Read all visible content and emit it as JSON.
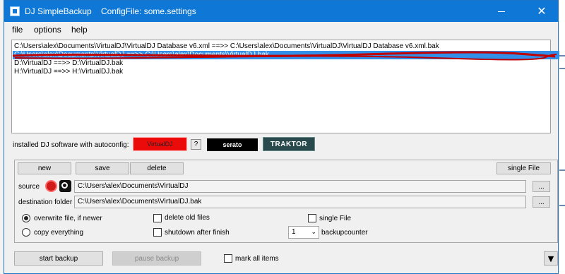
{
  "window": {
    "app_title": "DJ SimpleBackup",
    "config_title": "ConfigFile: some.settings",
    "minimize_glyph": "",
    "close_glyph": "✕"
  },
  "menu": [
    {
      "label": "file"
    },
    {
      "label": "options"
    },
    {
      "label": "help"
    }
  ],
  "backup_list": [
    {
      "text": "C:\\Users\\alex\\Documents\\VirtualDJ\\VirtualDJ Database v6.xml  ==>>  C:\\Users\\alex\\Documents\\VirtualDJ\\VirtualDJ Database v6.xml.bak",
      "selected": false
    },
    {
      "text": "C:\\Users\\alex\\Documents\\VirtualDJ  ==>>  C:\\Users\\alex\\Documents\\VirtualDJ.bak",
      "selected": true
    },
    {
      "text": "D:\\VirtualDJ  ==>>  D:\\VirtualDJ.bak",
      "selected": false
    },
    {
      "text": "H:\\VirtualDJ  ==>>  H:\\VirtualDJ.bak",
      "selected": false
    }
  ],
  "autoconfig": {
    "label": "installed DJ software with autoconfig:",
    "virtualdj": "VirtualDJ",
    "help": "?",
    "serato": "serato",
    "traktor": "TRAKTOR"
  },
  "actions": {
    "new": "new",
    "save": "save",
    "delete": "delete",
    "single_file": "single File"
  },
  "source": {
    "label": "source",
    "value": "C:\\Users\\alex\\Documents\\VirtualDJ",
    "browse": "..."
  },
  "destination": {
    "label": "destination folder",
    "value": "C:\\Users\\alex\\Documents\\VirtualDJ.bak",
    "browse": "..."
  },
  "options": {
    "overwrite": "overwrite file, if newer",
    "copy_everything": "copy everything",
    "delete_old": "delete old files",
    "shutdown": "shutdown after finish",
    "single_file": "single File",
    "backupcounter_value": "1",
    "backupcounter_label": "backupcounter",
    "selected_mode": "overwrite"
  },
  "footer": {
    "start": "start backup",
    "pause": "pause backup",
    "mark_all": "mark all items",
    "dropdown": "▼"
  }
}
